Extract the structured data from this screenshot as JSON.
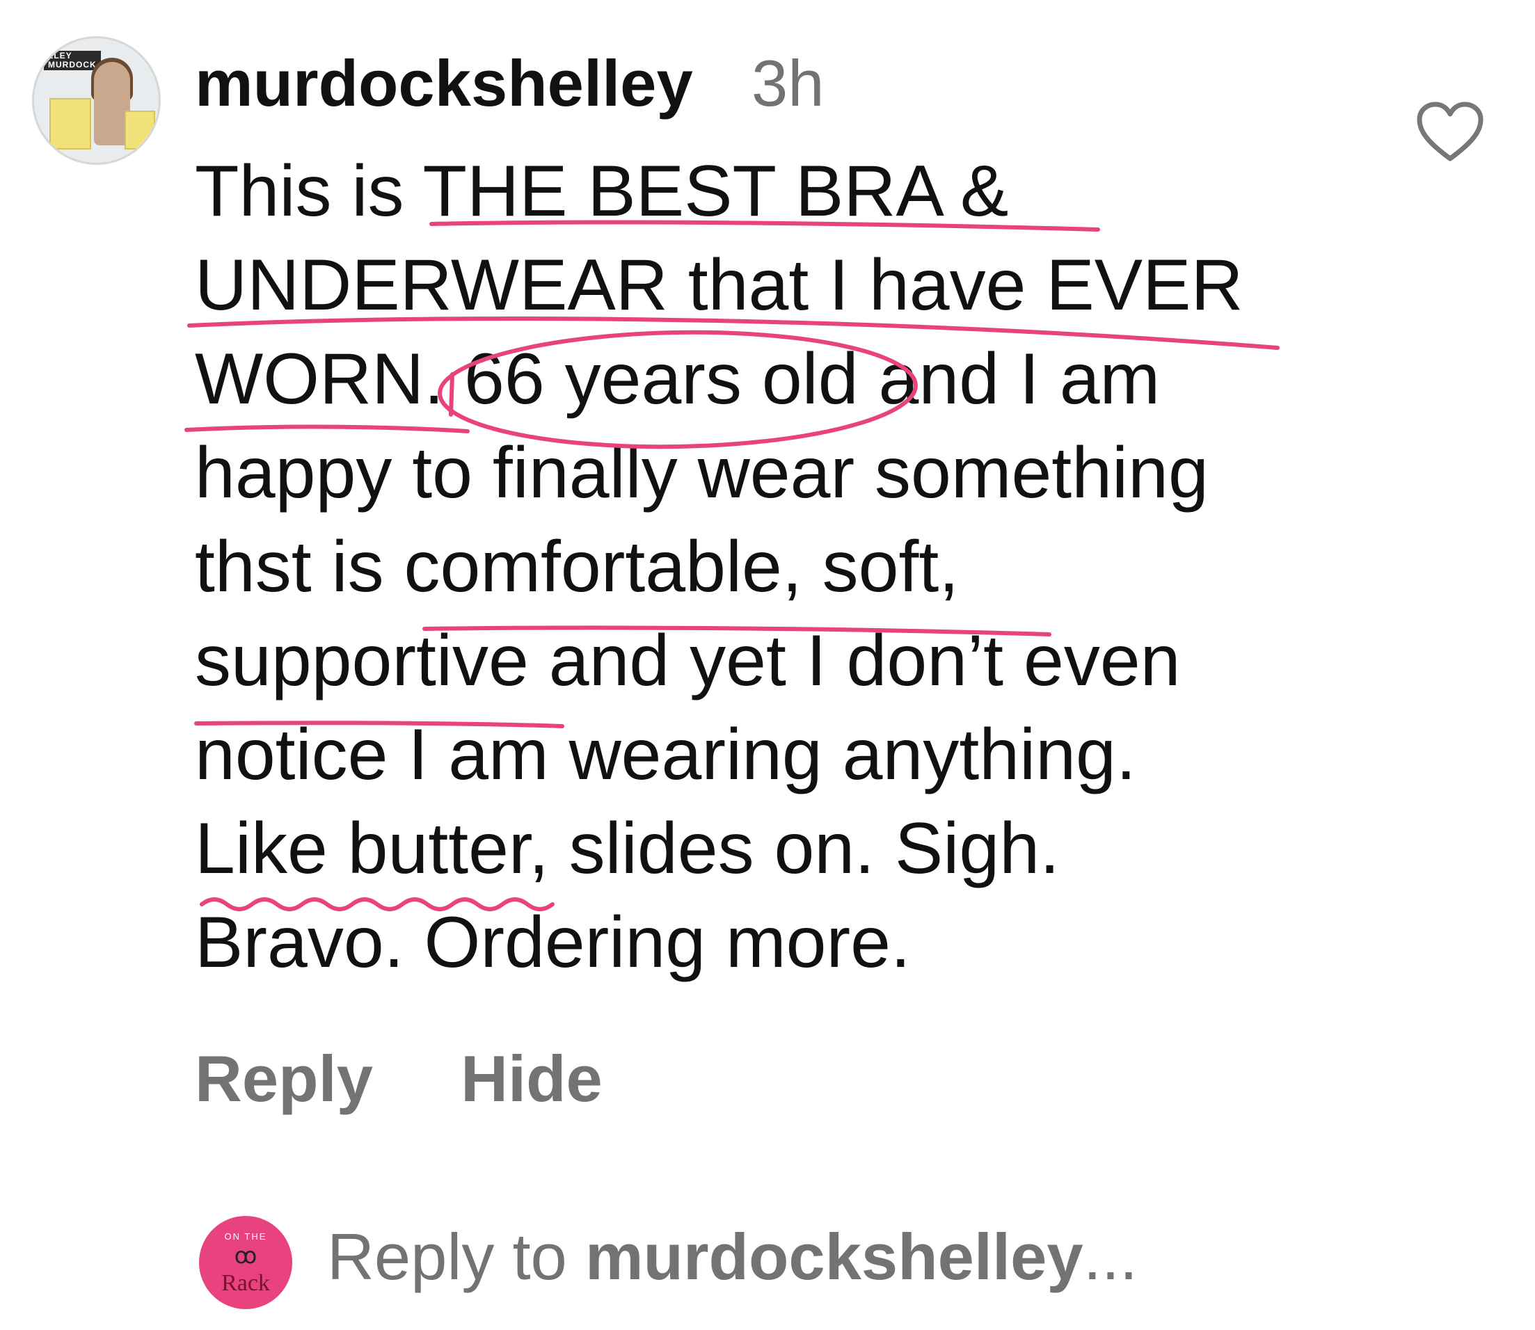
{
  "comment": {
    "username": "murdockshelley",
    "time": "3h",
    "avatar": {
      "tag_line1": "LLEY",
      "tag_line2": "MURDOCK"
    },
    "text_lines": [
      "This is THE BEST BRA &",
      "UNDERWEAR that I have EVER",
      "WORN. 66 years old and I am",
      "happy to finally wear something",
      "thst is comfortable, soft,",
      "supportive and yet I don’t even",
      "notice I am wearing anything.",
      "Like butter, slides on. Sigh.",
      "Bravo. Ordering more."
    ],
    "like_icon": "heart-icon",
    "actions": {
      "reply": "Reply",
      "hide": "Hide"
    }
  },
  "reply_box": {
    "avatar": {
      "top_text": "ON THE",
      "glyph": "ꝏ",
      "brand": "Rack"
    },
    "prefix": "Reply to ",
    "username": "murdockshelley",
    "suffix": "..."
  },
  "colors": {
    "annotation": "#e8427f",
    "secondary_text": "#737373",
    "primary_text": "#111111"
  }
}
